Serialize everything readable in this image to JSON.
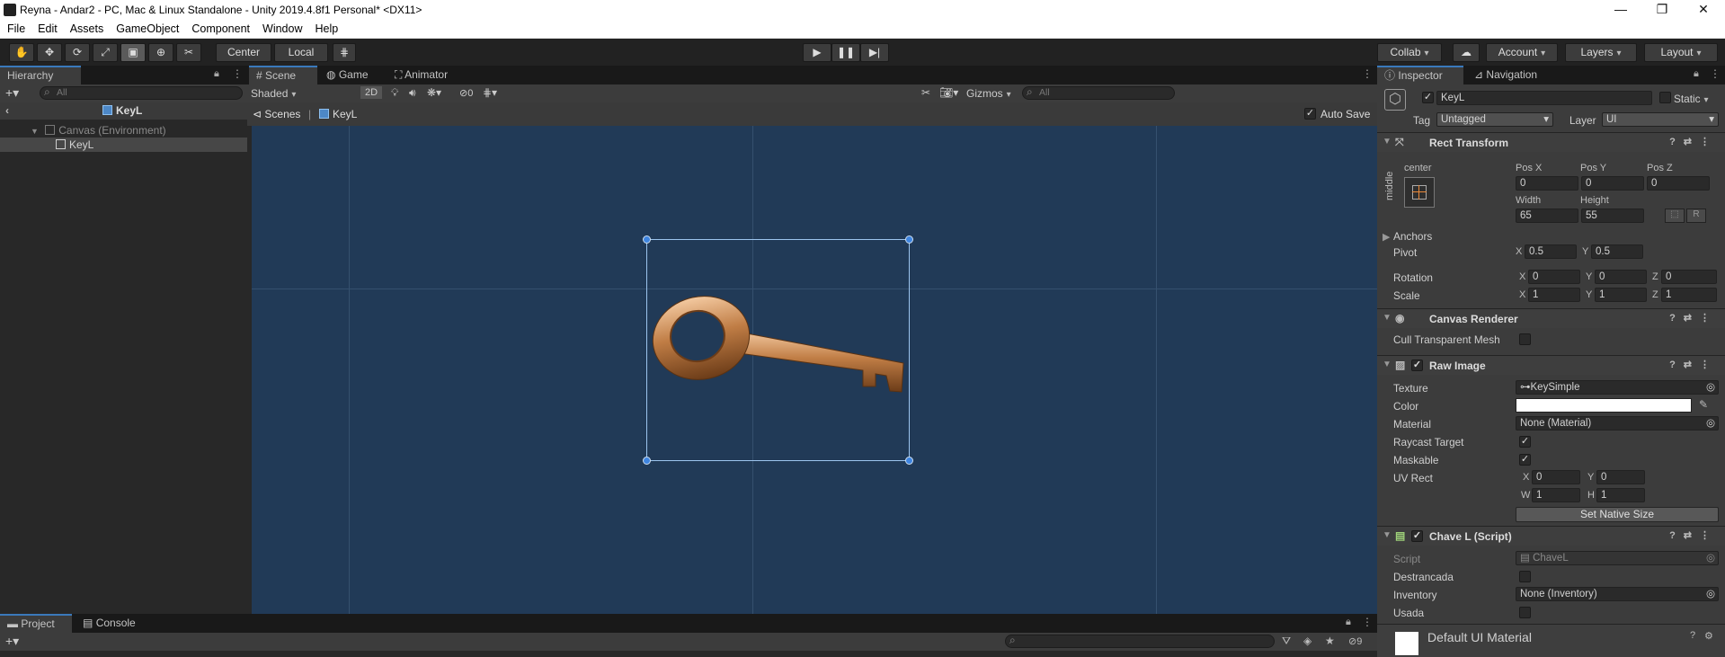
{
  "window": {
    "title": "Reyna - Andar2 - PC, Mac & Linux Standalone - Unity 2019.4.8f1 Personal* <DX11>",
    "minimize": "—",
    "maximize": "❐",
    "close": "✕"
  },
  "menu": [
    "File",
    "Edit",
    "Assets",
    "GameObject",
    "Component",
    "Window",
    "Help"
  ],
  "toolbar": {
    "pivot": "Center",
    "space": "Local",
    "collab": "Collab",
    "account": "Account",
    "layers": "Layers",
    "layout": "Layout"
  },
  "hierarchy": {
    "tab": "Hierarchy",
    "search_placeholder": "All",
    "header": "KeyL",
    "items": [
      {
        "label": "Canvas (Environment)"
      },
      {
        "label": "KeyL"
      }
    ]
  },
  "scene": {
    "tabs": [
      "Scene",
      "Game",
      "Animator"
    ],
    "shading": "Shaded",
    "mode2d": "2D",
    "hidden_count": "0",
    "gizmos": "Gizmos",
    "search_placeholder": "All",
    "breadcrumb_root": "Scenes",
    "breadcrumb_item": "KeyL",
    "auto_save": "Auto Save"
  },
  "bottom": {
    "tabs": [
      "Project",
      "Console"
    ],
    "count": "9"
  },
  "inspector": {
    "tabs": [
      "Inspector",
      "Navigation"
    ],
    "object_name": "KeyL",
    "static_label": "Static",
    "tag_label": "Tag",
    "tag_value": "Untagged",
    "layer_label": "Layer",
    "layer_value": "UI",
    "rect": {
      "title": "Rect Transform",
      "anchor_h": "center",
      "anchor_v": "middle",
      "posx_label": "Pos X",
      "posy_label": "Pos Y",
      "posz_label": "Pos Z",
      "posx": "0",
      "posy": "0",
      "posz": "0",
      "width_label": "Width",
      "height_label": "Height",
      "width": "65",
      "height": "55",
      "btn_r": "R",
      "anchors": "Anchors",
      "pivot": "Pivot",
      "pivot_x": "0.5",
      "pivot_y": "0.5",
      "rotation": "Rotation",
      "rot_x": "0",
      "rot_y": "0",
      "rot_z": "0",
      "scale": "Scale",
      "scale_x": "1",
      "scale_y": "1",
      "scale_z": "1",
      "x": "X",
      "y": "Y",
      "z": "Z"
    },
    "canvas_renderer": {
      "title": "Canvas Renderer",
      "cull": "Cull Transparent Mesh"
    },
    "raw_image": {
      "title": "Raw Image",
      "texture_label": "Texture",
      "texture_value": "KeySimple",
      "color_label": "Color",
      "material_label": "Material",
      "material_value": "None (Material)",
      "raycast": "Raycast Target",
      "maskable": "Maskable",
      "uv_rect": "UV Rect",
      "uv_x": "0",
      "uv_y": "0",
      "uv_w": "1",
      "uv_h": "1",
      "w": "W",
      "h": "H",
      "native": "Set Native Size"
    },
    "script": {
      "title": "Chave L (Script)",
      "script_label": "Script",
      "script_value": "ChaveL",
      "destrancada": "Destrancada",
      "inventory_label": "Inventory",
      "inventory_value": "None (Inventory)",
      "usada": "Usada"
    },
    "material": {
      "title": "Default UI Material"
    }
  }
}
